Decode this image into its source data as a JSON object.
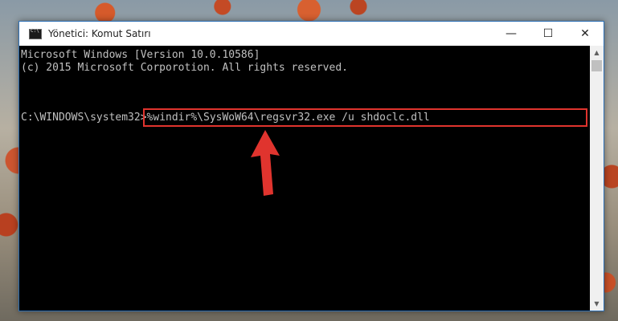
{
  "window": {
    "title": "Yönetici: Komut Satırı",
    "controls": {
      "minimize": "—",
      "maximize": "☐",
      "close": "✕"
    }
  },
  "console": {
    "lines": [
      "Microsoft Windows [Version 10.0.10586]",
      "(c) 2015 Microsoft Corporotion. All rights reserved."
    ],
    "prompt": "C:\\WINDOWS\\system32>",
    "command": "%windir%\\SysWoW64\\regsvr32.exe /u shdoclc.dll"
  },
  "colors": {
    "console_bg": "#000000",
    "console_text": "#c0c0c0",
    "highlight": "#e0342e"
  },
  "icons": {
    "app": "cmd-icon",
    "annotation": "arrow-up-icon"
  }
}
